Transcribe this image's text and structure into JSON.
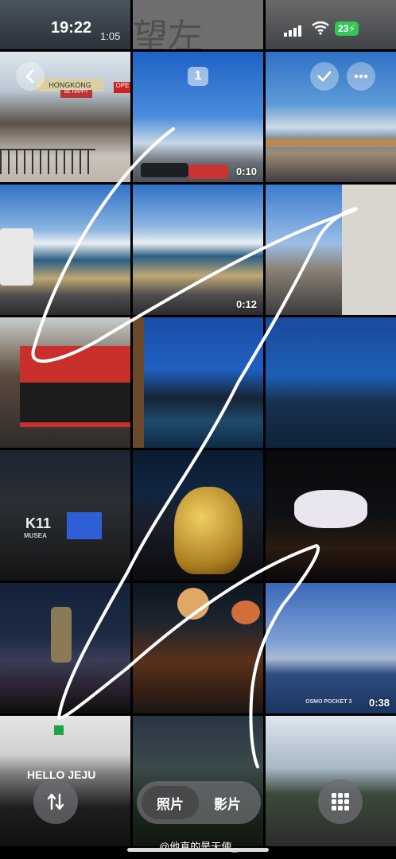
{
  "status_bar": {
    "time": "19:22",
    "sub_time": "1:05",
    "battery": "23"
  },
  "top_bar": {
    "back_icon": "chevron-left-icon",
    "select_icon": "checkmark-icon",
    "more_icon": "ellipsis-icon",
    "selection_count": "1"
  },
  "photos": [
    {
      "label": "HONGKONG",
      "sublabel": "BE HAPPY",
      "sign": "OPE"
    },
    {
      "duration": "0:10"
    },
    {},
    {},
    {
      "duration": "0:12"
    },
    {},
    {},
    {},
    {},
    {
      "label": "K11",
      "sublabel": "MUSEA"
    },
    {},
    {},
    {},
    {},
    {
      "duration": "0:38",
      "watermark": "OSMO POCKET 3"
    },
    {
      "label": "HELLO JEJU"
    },
    {},
    {}
  ],
  "bottom_bar": {
    "sort_icon": "arrow-up-down-icon",
    "segment": {
      "photos": "照片",
      "videos": "影片",
      "selected": "photos"
    },
    "grid_icon": "grid-icon"
  },
  "watermark": "@他真的是天使_"
}
